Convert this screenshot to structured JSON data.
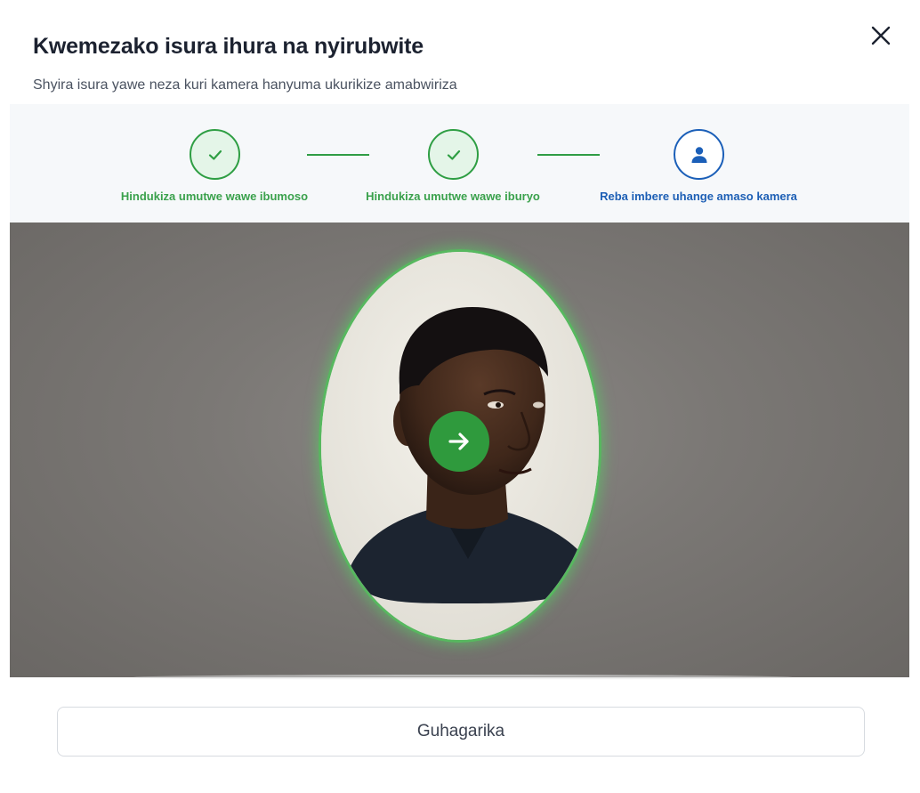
{
  "dialog": {
    "title": "Kwemezako isura ihura na nyirubwite",
    "subtitle": "Shyira isura yawe neza kuri kamera hanyuma ukurikize amabwiriza",
    "close_icon": "close-icon"
  },
  "steps": [
    {
      "label": "Hindukiza umutwe wawe ibumoso",
      "status": "done",
      "icon": "check-icon"
    },
    {
      "label": "Hindukiza umutwe wawe iburyo",
      "status": "done",
      "icon": "check-icon"
    },
    {
      "label": "Reba imbere uhange amaso kamera",
      "status": "active",
      "icon": "user-icon"
    }
  ],
  "camera": {
    "guide_icon": "arrow-right-icon"
  },
  "footer": {
    "cancel_label": "Guhagarika"
  },
  "colors": {
    "done_green": "#2e9e43",
    "active_blue": "#1b5fb8",
    "oval_border": "#57b85f",
    "arrow_button": "#2f9a3d"
  }
}
